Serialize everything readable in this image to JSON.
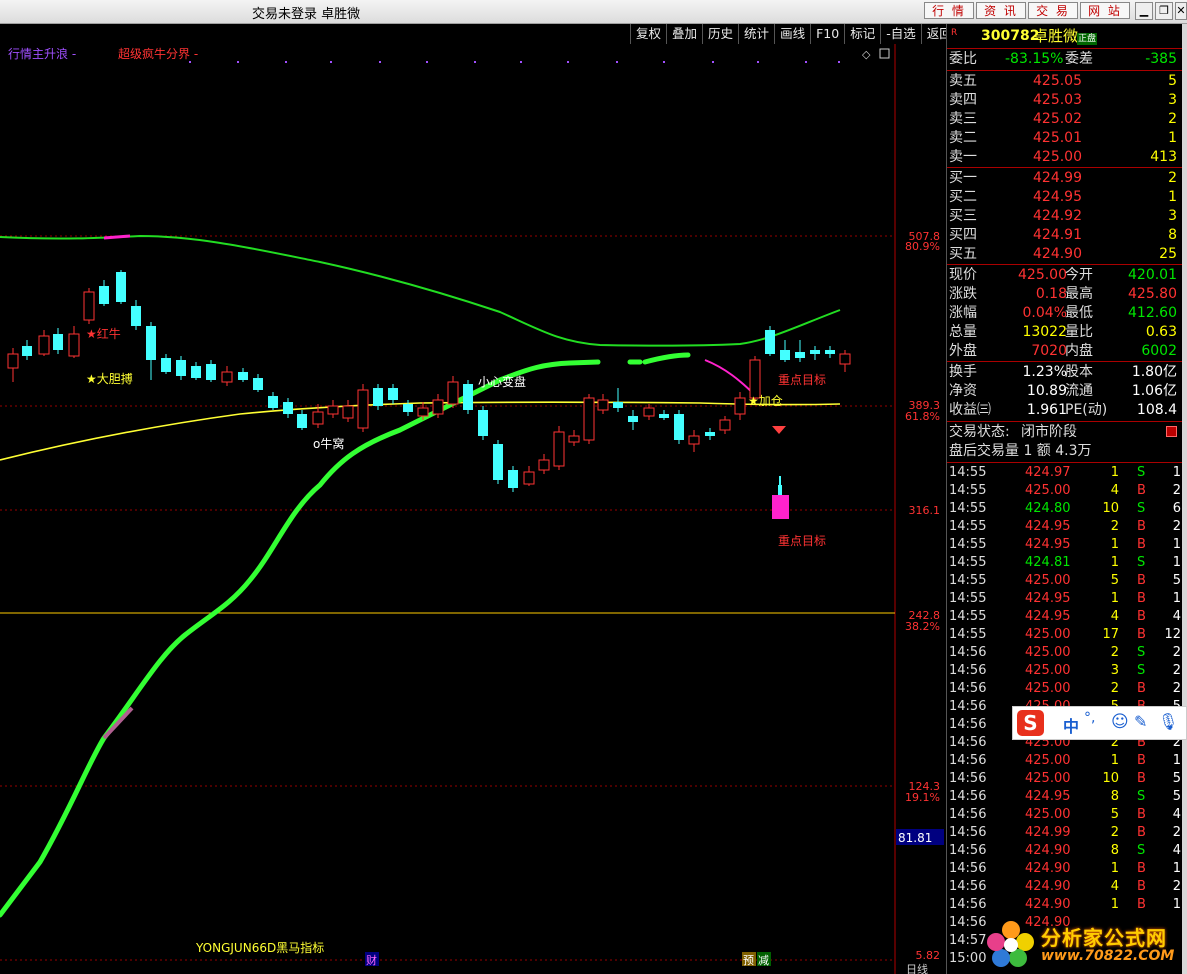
{
  "window": {
    "title": "交易未登录  卓胜微",
    "top_buttons": [
      "行 情",
      "资 讯",
      "交 易",
      "网 站"
    ],
    "win_controls": [
      "▁",
      "❐",
      "✕"
    ]
  },
  "toolbar": [
    "复权",
    "叠加",
    "历史",
    "统计",
    "画线",
    "F10",
    "标记",
    "-自选",
    "返回"
  ],
  "chart": {
    "legend_1": "行情主升浪 -",
    "legend_2": "超级疯牛分界 -",
    "price_labels": [
      "507.8",
      "389.3",
      "316.1",
      "242.8",
      "124.3",
      "5.82"
    ],
    "pct_labels": [
      "80.9%",
      "61.8%",
      "38.2%",
      "19.1%"
    ],
    "value_box": "81.81",
    "annotations": {
      "hongniu": "★红牛",
      "dadanbo": "★大胆搏",
      "niuwo": "o牛窝",
      "xiaoxin": "小心变盘",
      "zhongdian1": "重点目标",
      "zhongdian2": "重点目标",
      "zhuanzhang": "★加仓"
    },
    "indicator_name": "YONGJUN66D黑马指标",
    "bottom_tag_cai": "财",
    "bottom_tag_yu": "预",
    "bottom_tag_jian": "减",
    "period": "日线",
    "colors": {
      "green_band": "#33ff33",
      "ma_green": "#22dd22",
      "ma_yellow": "#ffff33",
      "magenta": "#ff22cc",
      "up": "#ff3333",
      "down": "#44ffff"
    }
  },
  "quote": {
    "badge": "R",
    "code": "300782",
    "name": "卓胜微",
    "tag": "正盘",
    "weibi_label": "委比",
    "weibi": "-83.15%",
    "weicha_label": "委差",
    "weicha": "-385",
    "asks": [
      {
        "label": "卖五",
        "price": "425.05",
        "vol": "5"
      },
      {
        "label": "卖四",
        "price": "425.03",
        "vol": "3"
      },
      {
        "label": "卖三",
        "price": "425.02",
        "vol": "2"
      },
      {
        "label": "卖二",
        "price": "425.01",
        "vol": "1"
      },
      {
        "label": "卖一",
        "price": "425.00",
        "vol": "413"
      }
    ],
    "bids": [
      {
        "label": "买一",
        "price": "424.99",
        "vol": "2"
      },
      {
        "label": "买二",
        "price": "424.95",
        "vol": "1"
      },
      {
        "label": "买三",
        "price": "424.92",
        "vol": "3"
      },
      {
        "label": "买四",
        "price": "424.91",
        "vol": "8"
      },
      {
        "label": "买五",
        "price": "424.90",
        "vol": "25"
      }
    ],
    "stats": [
      {
        "l1": "现价",
        "v1": "425.00",
        "c1": "red",
        "l2": "今开",
        "v2": "420.01",
        "c2": "grn"
      },
      {
        "l1": "涨跌",
        "v1": "0.18",
        "c1": "red",
        "l2": "最高",
        "v2": "425.80",
        "c2": "red"
      },
      {
        "l1": "涨幅",
        "v1": "0.04%",
        "c1": "red",
        "l2": "最低",
        "v2": "412.60",
        "c2": "grn"
      },
      {
        "l1": "总量",
        "v1": "13022",
        "c1": "yel",
        "l2": "量比",
        "v2": "0.63",
        "c2": "yel"
      },
      {
        "l1": "外盘",
        "v1": "7020",
        "c1": "red",
        "l2": "内盘",
        "v2": "6002",
        "c2": "grn"
      }
    ],
    "stats2": [
      {
        "l1": "换手",
        "v1": "1.23%",
        "l2": "股本",
        "v2": "1.80亿"
      },
      {
        "l1": "净资",
        "v1": "10.89",
        "l2": "流通",
        "v2": "1.06亿"
      },
      {
        "l1": "收益㈢",
        "v1": "1.961",
        "l2": "PE(动)",
        "v2": "108.4"
      }
    ],
    "status_label": "交易状态:",
    "status_value": "闭市阶段",
    "after_label": "盘后交易量 1 额 4.3万"
  },
  "trades": [
    {
      "t": "14:55",
      "p": "424.97",
      "v": "1",
      "s": "S",
      "n": "1"
    },
    {
      "t": "14:55",
      "p": "425.00",
      "v": "4",
      "s": "B",
      "n": "2"
    },
    {
      "t": "14:55",
      "p": "424.80",
      "v": "10",
      "s": "S",
      "n": "6"
    },
    {
      "t": "14:55",
      "p": "424.95",
      "v": "2",
      "s": "B",
      "n": "2"
    },
    {
      "t": "14:55",
      "p": "424.95",
      "v": "1",
      "s": "B",
      "n": "1"
    },
    {
      "t": "14:55",
      "p": "424.81",
      "v": "1",
      "s": "S",
      "n": "1"
    },
    {
      "t": "14:55",
      "p": "425.00",
      "v": "5",
      "s": "B",
      "n": "5"
    },
    {
      "t": "14:55",
      "p": "424.95",
      "v": "1",
      "s": "B",
      "n": "1"
    },
    {
      "t": "14:55",
      "p": "424.95",
      "v": "4",
      "s": "B",
      "n": "4"
    },
    {
      "t": "14:55",
      "p": "425.00",
      "v": "17",
      "s": "B",
      "n": "12"
    },
    {
      "t": "14:56",
      "p": "425.00",
      "v": "2",
      "s": "S",
      "n": "2"
    },
    {
      "t": "14:56",
      "p": "425.00",
      "v": "3",
      "s": "S",
      "n": "2"
    },
    {
      "t": "14:56",
      "p": "425.00",
      "v": "2",
      "s": "B",
      "n": "2"
    },
    {
      "t": "14:56",
      "p": "425.00",
      "v": "5",
      "s": "B",
      "n": "5"
    },
    {
      "t": "14:56",
      "p": "425.00",
      "v": "2",
      "s": "B",
      "n": "2"
    },
    {
      "t": "14:56",
      "p": "425.00",
      "v": "2",
      "s": "B",
      "n": "2"
    },
    {
      "t": "14:56",
      "p": "425.00",
      "v": "1",
      "s": "B",
      "n": "1"
    },
    {
      "t": "14:56",
      "p": "425.00",
      "v": "10",
      "s": "B",
      "n": "5"
    },
    {
      "t": "14:56",
      "p": "424.95",
      "v": "8",
      "s": "S",
      "n": "5"
    },
    {
      "t": "14:56",
      "p": "425.00",
      "v": "5",
      "s": "B",
      "n": "4"
    },
    {
      "t": "14:56",
      "p": "424.99",
      "v": "2",
      "s": "B",
      "n": "2"
    },
    {
      "t": "14:56",
      "p": "424.90",
      "v": "8",
      "s": "S",
      "n": "4"
    },
    {
      "t": "14:56",
      "p": "424.90",
      "v": "1",
      "s": "B",
      "n": "1"
    },
    {
      "t": "14:56",
      "p": "424.90",
      "v": "4",
      "s": "B",
      "n": "2"
    },
    {
      "t": "14:56",
      "p": "424.90",
      "v": "1",
      "s": "B",
      "n": "1"
    },
    {
      "t": "14:56",
      "p": "424.90",
      "v": "",
      "s": "",
      "n": ""
    },
    {
      "t": "14:57",
      "p": "",
      "v": "",
      "s": "",
      "n": ""
    },
    {
      "t": "15:00",
      "p": "",
      "v": "",
      "s": "",
      "n": ""
    }
  ],
  "ime": {
    "lang": "中",
    "punct": "°,"
  },
  "watermark": {
    "line1": "分析家公式网",
    "line2": "www.70822.COM"
  }
}
